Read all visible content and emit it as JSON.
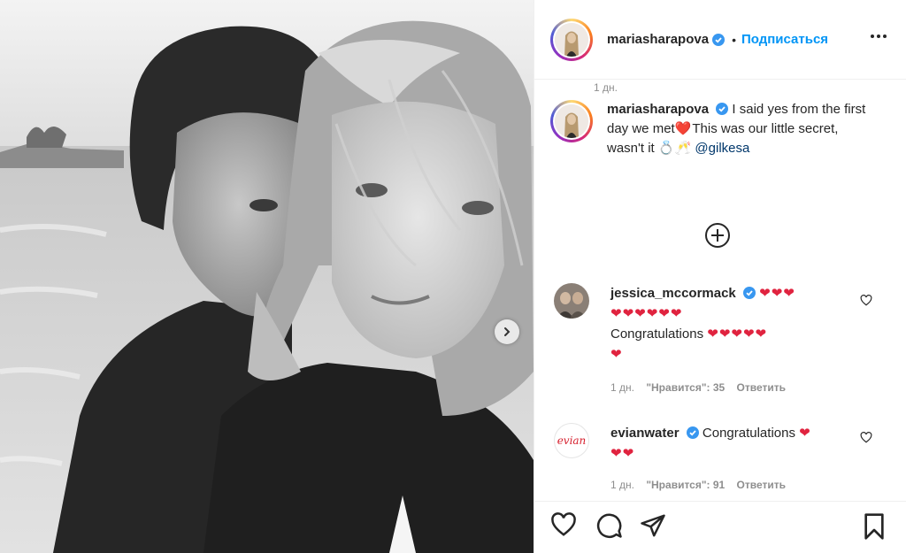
{
  "post": {
    "author": "mariasharapova",
    "verified": true,
    "follow_label": "Подписаться",
    "header_dot": "•"
  },
  "caption": {
    "username": "mariasharapova",
    "text_part1": "I said yes from the first day we met",
    "heart": "❤️",
    "text_part2": "This was our little secret, wasn't it ",
    "emoji": "💍🥂",
    "mention": "@gilkesa",
    "time": "1 дн."
  },
  "comments": [
    {
      "username": "jessica_mccormack",
      "verified": true,
      "hearts_line1": "❤❤❤",
      "hearts_line2": "❤❤❤❤❤❤",
      "text": "Congratulations",
      "hearts_after": "❤❤❤❤❤",
      "hearts_line4": "❤",
      "time": "1 дн.",
      "likes": "\"Нравится\": 35",
      "reply": "Ответить"
    },
    {
      "username": "evianwater",
      "avatar_text": "evian",
      "verified": true,
      "text": "Congratulations",
      "hearts_after": "❤",
      "hearts_line2": "❤❤",
      "time": "1 дн.",
      "likes": "\"Нравится\": 91",
      "reply": "Ответить"
    }
  ],
  "icons": {
    "like": "heart-icon",
    "comment": "comment-icon",
    "share": "share-icon",
    "save": "bookmark-icon",
    "more": "more-options-icon",
    "next": "chevron-right-icon",
    "load_more": "plus-circle-icon"
  },
  "colors": {
    "accent": "#0095f6",
    "heart": "#e0233f",
    "meta": "#8e8e8e",
    "verified": "#3897f0"
  }
}
